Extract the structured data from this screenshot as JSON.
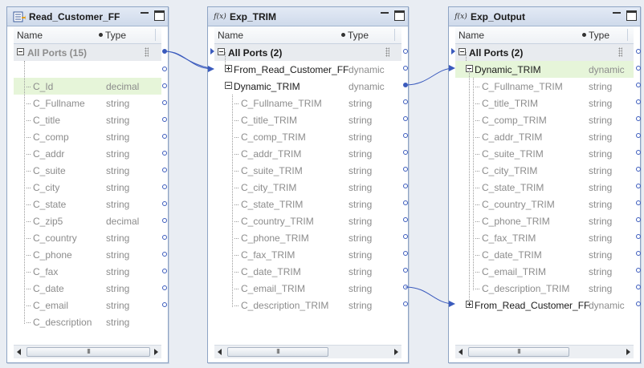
{
  "panels": {
    "read_customer_ff": {
      "title": "Read_Customer_FF",
      "header": {
        "name": "Name",
        "type": "Type"
      },
      "all_ports": "All Ports (15)",
      "ports": [
        {
          "name": "C_Id",
          "type": "decimal"
        },
        {
          "name": "C_Fullname",
          "type": "string"
        },
        {
          "name": "C_title",
          "type": "string"
        },
        {
          "name": "C_comp",
          "type": "string"
        },
        {
          "name": "C_addr",
          "type": "string"
        },
        {
          "name": "C_suite",
          "type": "string"
        },
        {
          "name": "C_city",
          "type": "string"
        },
        {
          "name": "C_state",
          "type": "string"
        },
        {
          "name": "C_zip5",
          "type": "decimal"
        },
        {
          "name": "C_country",
          "type": "string"
        },
        {
          "name": "C_phone",
          "type": "string"
        },
        {
          "name": "C_fax",
          "type": "string"
        },
        {
          "name": "C_date",
          "type": "string"
        },
        {
          "name": "C_email",
          "type": "string"
        },
        {
          "name": "C_description",
          "type": "string"
        }
      ],
      "scroll_thumb": "III"
    },
    "exp_trim": {
      "title": "Exp_TRIM",
      "icon_text": "f(x)",
      "header": {
        "name": "Name",
        "type": "Type"
      },
      "all_ports": "All Ports (2)",
      "groups": [
        {
          "name": "From_Read_Customer_FF",
          "type": "dynamic"
        },
        {
          "name": "Dynamic_TRIM",
          "type": "dynamic"
        }
      ],
      "ports": [
        {
          "name": "C_Fullname_TRIM",
          "type": "string"
        },
        {
          "name": "C_title_TRIM",
          "type": "string"
        },
        {
          "name": "C_comp_TRIM",
          "type": "string"
        },
        {
          "name": "C_addr_TRIM",
          "type": "string"
        },
        {
          "name": "C_suite_TRIM",
          "type": "string"
        },
        {
          "name": "C_city_TRIM",
          "type": "string"
        },
        {
          "name": "C_state_TRIM",
          "type": "string"
        },
        {
          "name": "C_country_TRIM",
          "type": "string"
        },
        {
          "name": "C_phone_TRIM",
          "type": "string"
        },
        {
          "name": "C_fax_TRIM",
          "type": "string"
        },
        {
          "name": "C_date_TRIM",
          "type": "string"
        },
        {
          "name": "C_email_TRIM",
          "type": "string"
        },
        {
          "name": "C_description_TRIM",
          "type": "string"
        }
      ],
      "scroll_thumb": "III"
    },
    "exp_output": {
      "title": "Exp_Output",
      "icon_text": "f(x)",
      "header": {
        "name": "Name",
        "type": "Type"
      },
      "all_ports": "All Ports (2)",
      "groups": [
        {
          "name": "Dynamic_TRIM",
          "type": "dynamic"
        },
        {
          "name": "From_Read_Customer_FF",
          "type": "dynamic"
        }
      ],
      "ports": [
        {
          "name": "C_Fullname_TRIM",
          "type": "string"
        },
        {
          "name": "C_title_TRIM",
          "type": "string"
        },
        {
          "name": "C_comp_TRIM",
          "type": "string"
        },
        {
          "name": "C_addr_TRIM",
          "type": "string"
        },
        {
          "name": "C_suite_TRIM",
          "type": "string"
        },
        {
          "name": "C_city_TRIM",
          "type": "string"
        },
        {
          "name": "C_state_TRIM",
          "type": "string"
        },
        {
          "name": "C_country_TRIM",
          "type": "string"
        },
        {
          "name": "C_phone_TRIM",
          "type": "string"
        },
        {
          "name": "C_fax_TRIM",
          "type": "string"
        },
        {
          "name": "C_date_TRIM",
          "type": "string"
        },
        {
          "name": "C_email_TRIM",
          "type": "string"
        },
        {
          "name": "C_description_TRIM",
          "type": "string"
        }
      ],
      "scroll_thumb": "III"
    }
  },
  "colors": {
    "link": "#3b5bbd",
    "highlight_row": "#e6f5d9",
    "panel_border": "#8ea4c4"
  },
  "icons": {
    "source": "flat-file-source-icon",
    "expression": "expression-fx-icon"
  }
}
